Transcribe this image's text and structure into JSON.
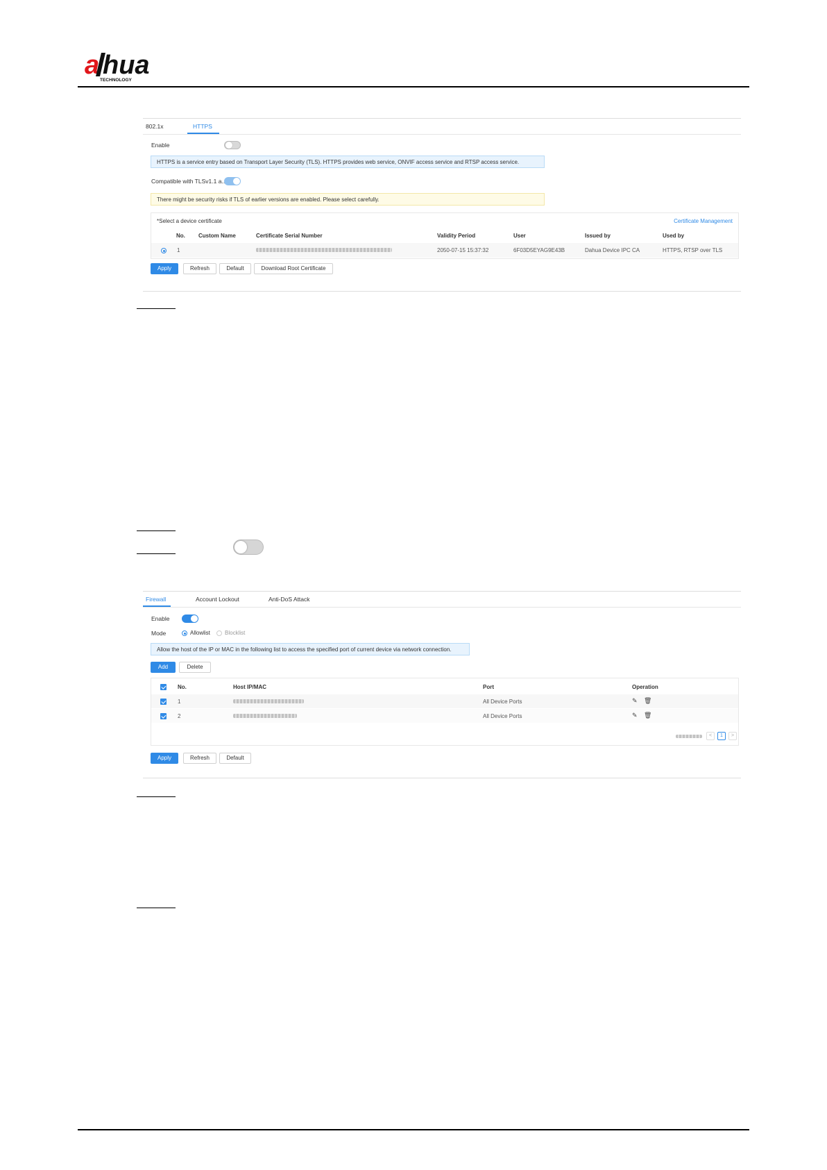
{
  "header": {
    "brand": "alhua",
    "brand_tagline": "TECHNOLOGY"
  },
  "https_screen": {
    "tabs": [
      "802.1x",
      "HTTPS"
    ],
    "enable_label": "Enable",
    "info_notice": "HTTPS is a service entry based on Transport Layer Security (TLS). HTTPS provides web service, ONVIF access service and RTSP access service.",
    "compat_label": "Compatible with TLSv1.1 a...",
    "warning_notice": "There might be security risks if TLS of earlier versions are enabled. Please select carefully.",
    "cert_select_label": "*Select a device certificate",
    "cert_management_link": "Certificate Management",
    "table_headers": [
      "No.",
      "Custom Name",
      "Certificate Serial Number",
      "Validity Period",
      "User",
      "Issued by",
      "Used by"
    ],
    "rows": [
      {
        "no": "1",
        "custom_name": "",
        "validity": "2050-07-15 15:37:32",
        "user": "6F03D5EYAG9E43B",
        "issued_by": "Dahua Device IPC CA",
        "used_by": "HTTPS, RTSP over TLS"
      }
    ],
    "buttons": {
      "apply": "Apply",
      "refresh": "Refresh",
      "default": "Default",
      "download": "Download Root Certificate"
    }
  },
  "firewall_screen": {
    "tabs": [
      "Firewall",
      "Account Lockout",
      "Anti-DoS Attack"
    ],
    "enable_label": "Enable",
    "mode_label": "Mode",
    "mode_options": [
      "Allowlist",
      "Blocklist"
    ],
    "info_notice": "Allow the host of the IP or MAC in the following list to access the specified port of current device via network connection.",
    "add_label": "Add",
    "delete_label": "Delete",
    "table_headers": [
      "No.",
      "Host IP/MAC",
      "Port",
      "Operation"
    ],
    "rows": [
      {
        "no": "1",
        "port": "All Device Ports"
      },
      {
        "no": "2",
        "port": "All Device Ports"
      }
    ],
    "pagination": {
      "current": "1",
      "prev": "<",
      "next": ">"
    },
    "buttons": {
      "apply": "Apply",
      "refresh": "Refresh",
      "default": "Default"
    }
  }
}
